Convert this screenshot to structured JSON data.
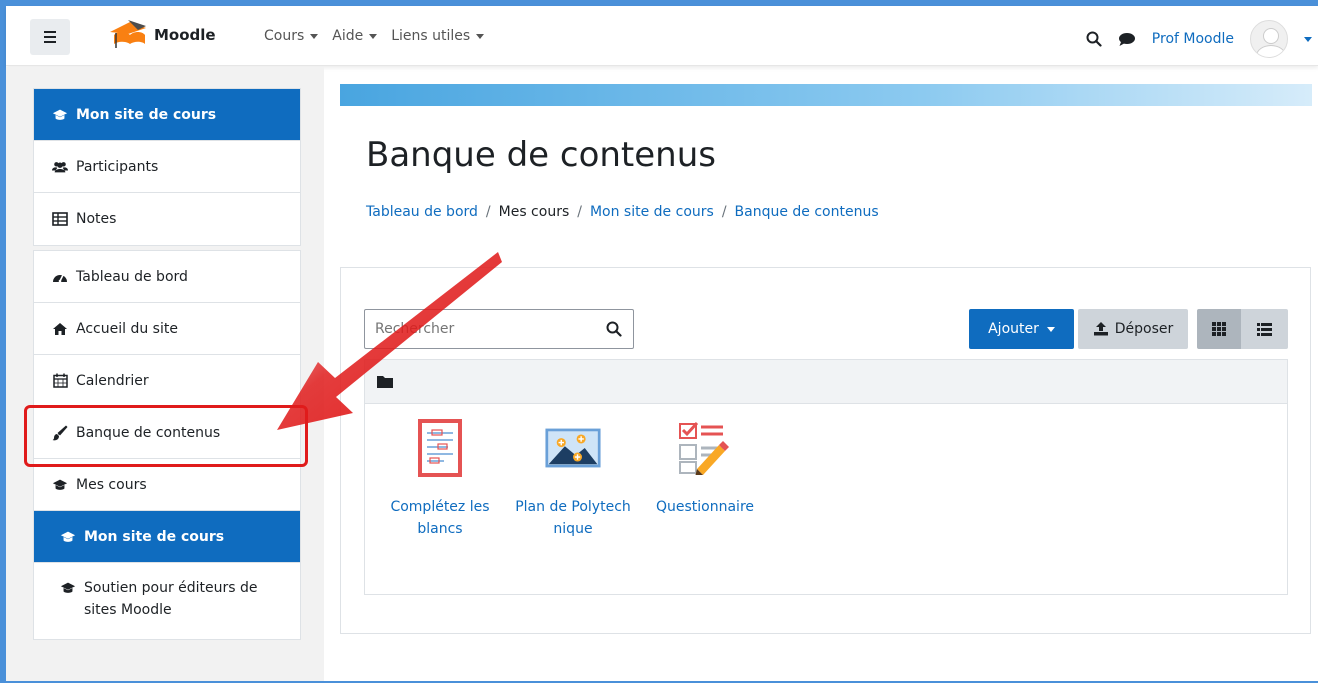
{
  "navbar": {
    "brand": "Moodle",
    "menu": [
      {
        "label": "Cours"
      },
      {
        "label": "Aide"
      },
      {
        "label": "Liens utiles"
      }
    ],
    "user_name": "Prof Moodle"
  },
  "drawer": {
    "group1": [
      {
        "label": "Mon site de cours",
        "icon": "graduation-cap-icon",
        "active": true
      },
      {
        "label": "Participants",
        "icon": "users-icon"
      },
      {
        "label": "Notes",
        "icon": "table-icon"
      }
    ],
    "group2": [
      {
        "label": "Tableau de bord",
        "icon": "tachometer-icon"
      },
      {
        "label": "Accueil du site",
        "icon": "home-icon"
      },
      {
        "label": "Calendrier",
        "icon": "calendar-icon"
      },
      {
        "label": "Banque de contenus",
        "icon": "paint-brush-icon"
      },
      {
        "label": "Mes cours",
        "icon": "graduation-cap-icon"
      },
      {
        "label": "Mon site de cours",
        "icon": "graduation-cap-icon",
        "active": true
      },
      {
        "label": "Soutien pour éditeurs de sites Moodle",
        "icon": "graduation-cap-icon"
      }
    ]
  },
  "page": {
    "title": "Banque de contenus",
    "breadcrumb": [
      {
        "label": "Tableau de bord"
      },
      {
        "label": "Mes cours"
      },
      {
        "label": "Mon site de cours"
      },
      {
        "label": "Banque de contenus"
      }
    ]
  },
  "content_bank": {
    "search_placeholder": "Rechercher",
    "add_label": "Ajouter",
    "upload_label": "Déposer",
    "files": [
      {
        "name": "Complétez les blancs",
        "icon": "fill-blanks-icon"
      },
      {
        "name": "Plan de Polytechnique",
        "icon": "image-hotspots-icon"
      },
      {
        "name": "Questionnaire",
        "icon": "questionnaire-icon"
      }
    ]
  },
  "colors": {
    "primary": "#0f6cbf",
    "highlight": "#e01b1b",
    "frame": "#4a90d9"
  }
}
